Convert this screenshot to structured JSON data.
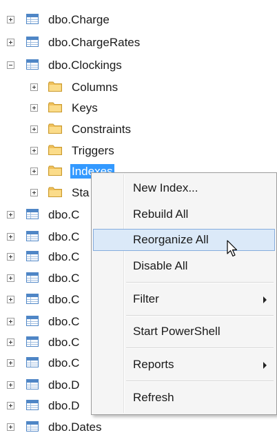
{
  "tree": {
    "items": [
      {
        "label": "dbo.Charge"
      },
      {
        "label": "dbo.ChargeRates"
      },
      {
        "label": "dbo.Clockings"
      },
      {
        "label": "Columns"
      },
      {
        "label": "Keys"
      },
      {
        "label": "Constraints"
      },
      {
        "label": "Triggers"
      },
      {
        "label": "Indexes"
      },
      {
        "label": "Sta"
      },
      {
        "label": "dbo.C"
      },
      {
        "label": "dbo.C"
      },
      {
        "label": "dbo.C"
      },
      {
        "label": "dbo.C"
      },
      {
        "label": "dbo.C"
      },
      {
        "label": "dbo.C"
      },
      {
        "label": "dbo.C"
      },
      {
        "label": "dbo.C"
      },
      {
        "label": "dbo.D"
      },
      {
        "label": "dbo.D"
      },
      {
        "label": "dbo.Dates"
      }
    ],
    "selected_index": 7
  },
  "context_menu": {
    "items": [
      {
        "label": "New Index..."
      },
      {
        "label": "Rebuild All"
      },
      {
        "label": "Reorganize All",
        "hovered": true
      },
      {
        "label": "Disable All"
      },
      {
        "label": "Filter",
        "submenu": true
      },
      {
        "label": "Start PowerShell"
      },
      {
        "label": "Reports",
        "submenu": true
      },
      {
        "label": "Refresh"
      }
    ]
  },
  "colors": {
    "selection": "#3399ff",
    "menu_hover": "#dbe9f8",
    "folder": "#f0c05a",
    "table_icon": "#4f86c6"
  }
}
